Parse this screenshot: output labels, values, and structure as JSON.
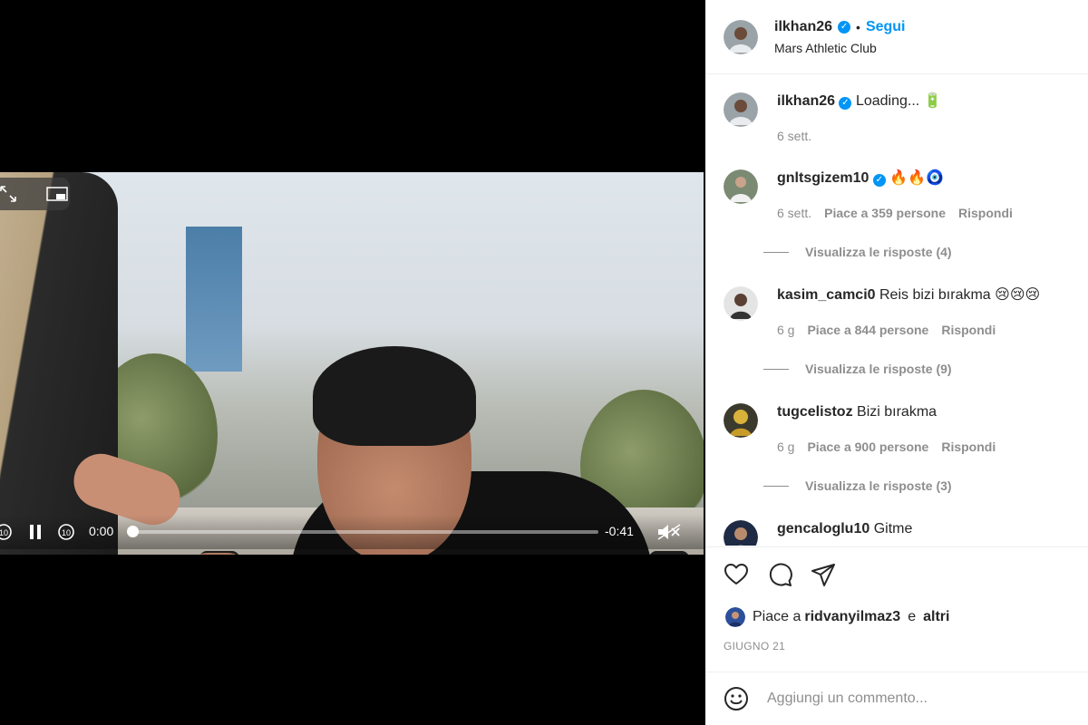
{
  "video": {
    "current_time": "0:00",
    "remaining_time": "-0:41",
    "progress_fraction": 0.0,
    "muted": true,
    "icons": [
      "expand-icon",
      "picture-in-picture-icon",
      "rewind-10-icon",
      "pause-icon",
      "forward-10-icon",
      "volume-muted-icon"
    ]
  },
  "header": {
    "username": "ilkhan26",
    "follow_label": "Segui",
    "separator": "•",
    "location": "Mars Athletic Club"
  },
  "caption": {
    "username": "ilkhan26",
    "text": "Loading... 🔋",
    "time": "6 sett."
  },
  "comments": [
    {
      "username": "gnltsgizem10",
      "verified": true,
      "text": "🔥🔥🧿",
      "time": "6 sett.",
      "likes": "Piace a 359 persone",
      "reply": "Rispondi",
      "view_replies": "Visualizza le risposte (4)"
    },
    {
      "username": "kasim_camci0",
      "verified": false,
      "text": "Reis bizi bırakma 😢😢😢",
      "time": "6 g",
      "likes": "Piace a 844 persone",
      "reply": "Rispondi",
      "view_replies": "Visualizza le risposte (9)"
    },
    {
      "username": "tugcelistoz",
      "verified": false,
      "text": "Bizi bırakma",
      "time": "6 g",
      "likes": "Piace a 900 persone",
      "reply": "Rispondi",
      "view_replies": "Visualizza le risposte (3)"
    },
    {
      "username": "gencaloglu10",
      "verified": false,
      "text": "Gitme"
    }
  ],
  "likes": {
    "prefix": "Piace a",
    "user": "ridvanyilmaz3",
    "conj": "e",
    "others": "altri"
  },
  "date": "GIUGNO 21",
  "add_comment": {
    "placeholder": "Aggiungi un commento..."
  },
  "colors": {
    "accent": "#0095f6",
    "muted_text": "#8e8e8e",
    "text": "#262626",
    "border": "#efefef"
  }
}
